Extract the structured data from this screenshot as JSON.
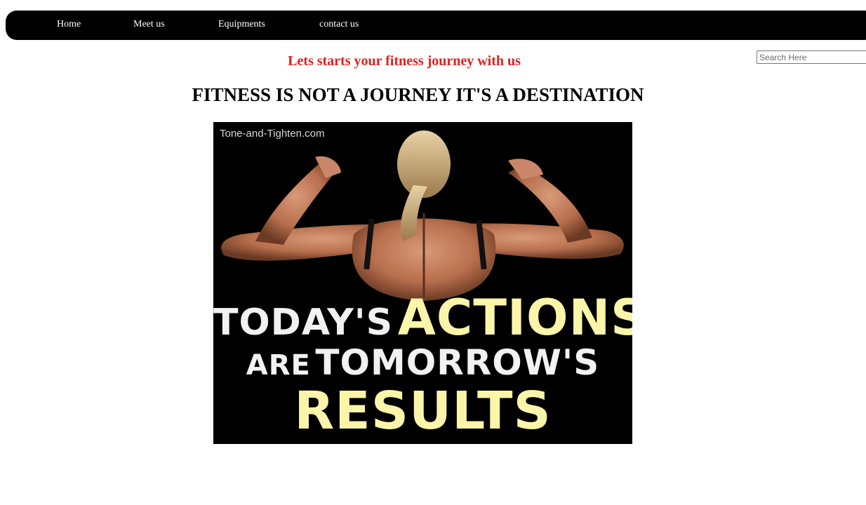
{
  "nav": {
    "items": [
      {
        "label": "Home"
      },
      {
        "label": "Meet us"
      },
      {
        "label": "Equipments"
      },
      {
        "label": "contact us"
      }
    ]
  },
  "search": {
    "placeholder": "Search Here",
    "value": ""
  },
  "subtitle": "Lets starts your fitness journey with us",
  "headline": "FITNESS IS NOT A JOURNEY IT'S A DESTINATION",
  "poster": {
    "watermark": "Tone-and-Tighten.com",
    "line1_a": "TODAY'S",
    "line1_b": "ACTIONS",
    "line2_a": "ARE",
    "line2_b": "TOMORROW'S",
    "line3": "RESULTS"
  },
  "colors": {
    "nav_bg": "#000000",
    "subtitle": "#e0201f",
    "poster_yellow": "#faf5a8"
  }
}
